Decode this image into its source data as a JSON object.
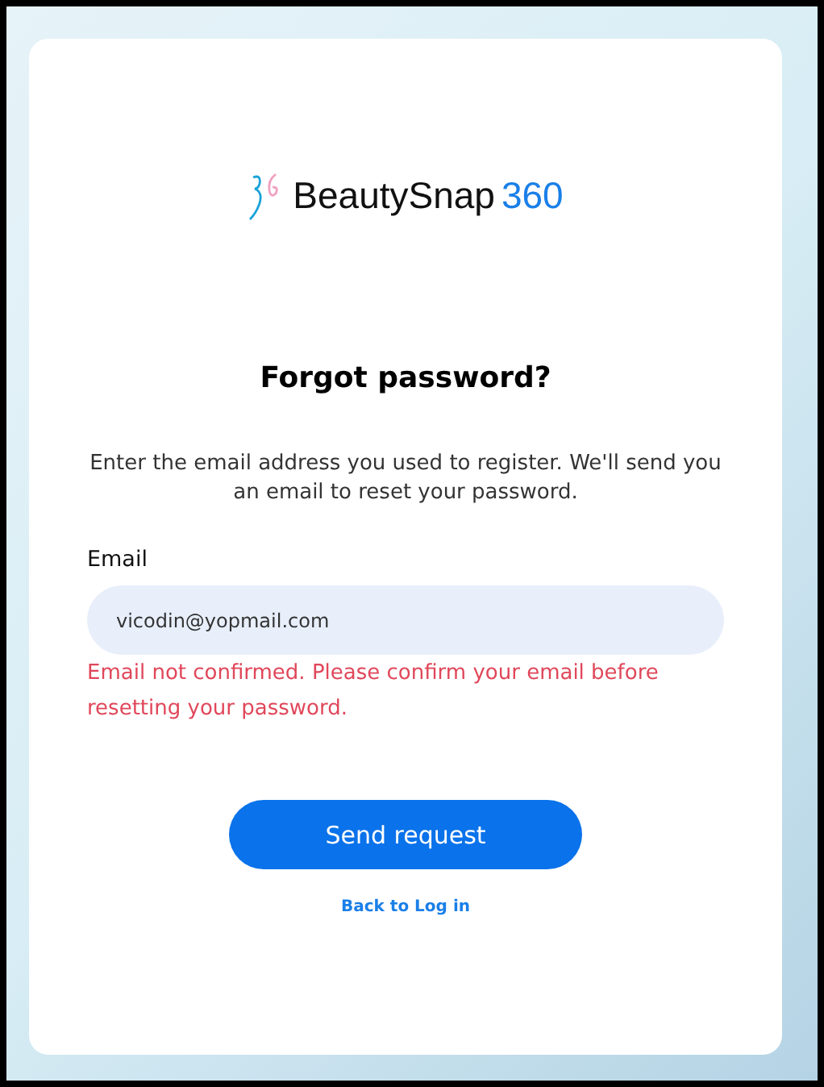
{
  "logo": {
    "name": "BeautySnap",
    "suffix": "360"
  },
  "title": "Forgot password?",
  "description": "Enter the email address you used to register. We'll send you an email to reset your password.",
  "email_field": {
    "label": "Email",
    "value": "vicodin@yopmail.com",
    "error": "Email not confirmed. Please confirm your email before resetting your password."
  },
  "submit_button": "Send request",
  "back_link": "Back to Log in"
}
